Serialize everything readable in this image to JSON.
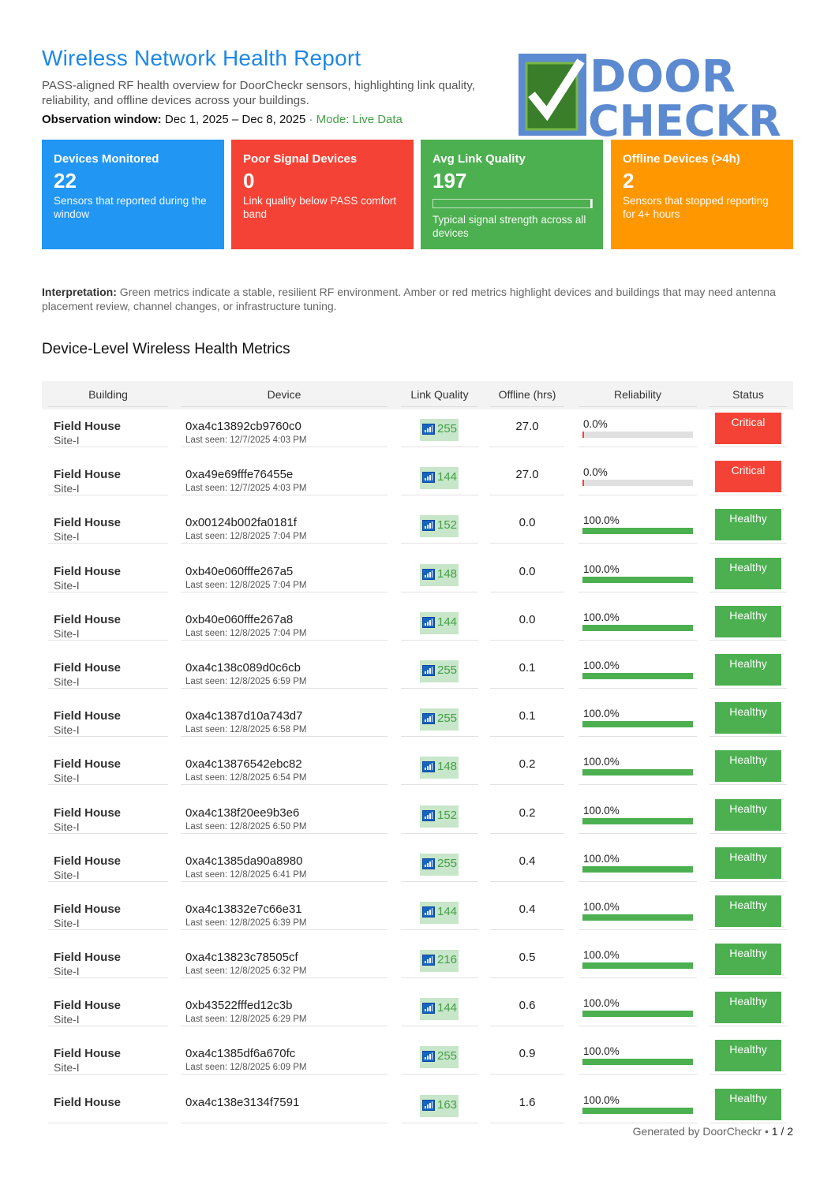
{
  "header": {
    "title": "Wireless Network Health Report",
    "subtitle": "PASS-aligned RF health overview for DoorCheckr sensors, highlighting link quality, reliability, and offline devices across your buildings.",
    "obs_label": "Observation window:",
    "obs_range": "Dec 1, 2025 – Dec 8, 2025",
    "obs_sep": " · ",
    "mode": "Mode: Live Data",
    "logo_text_1": "DOOR",
    "logo_text_2": "CHECKR"
  },
  "cards": [
    {
      "label": "Devices Monitored",
      "value": "22",
      "desc": "Sensors that reported during the window"
    },
    {
      "label": "Poor Signal Devices",
      "value": "0",
      "desc": "Link quality below PASS comfort band"
    },
    {
      "label": "Avg Link Quality",
      "value": "197",
      "desc": "Typical signal strength across all devices"
    },
    {
      "label": "Offline Devices (>4h)",
      "value": "2",
      "desc": "Sensors that stopped reporting for 4+ hours"
    }
  ],
  "avg_link_quality_fraction": 0.99,
  "interpretation": {
    "label": "Interpretation:",
    "text": " Green metrics indicate a stable, resilient RF environment. Amber or red metrics highlight devices and buildings that may need antenna placement review, channel changes, or infrastructure tuning."
  },
  "section_title": "Device-Level Wireless Health Metrics",
  "table": {
    "headers": [
      "Building",
      "Device",
      "Link Quality",
      "Offline (hrs)",
      "Reliability",
      "Status"
    ],
    "rows": [
      {
        "building": "Field House",
        "site": "Site-I",
        "device": "0xa4c13892cb9760c0",
        "seen": "Last seen: 12/7/2025 4:03 PM",
        "lq": "255",
        "offline": "27.0",
        "rel": "0.0%",
        "rel_frac": 0.0,
        "status": "Critical"
      },
      {
        "building": "Field House",
        "site": "Site-I",
        "device": "0xa49e69fffe76455e",
        "seen": "Last seen: 12/7/2025 4:03 PM",
        "lq": "144",
        "offline": "27.0",
        "rel": "0.0%",
        "rel_frac": 0.0,
        "status": "Critical"
      },
      {
        "building": "Field House",
        "site": "Site-I",
        "device": "0x00124b002fa0181f",
        "seen": "Last seen: 12/8/2025 7:04 PM",
        "lq": "152",
        "offline": "0.0",
        "rel": "100.0%",
        "rel_frac": 1.0,
        "status": "Healthy"
      },
      {
        "building": "Field House",
        "site": "Site-I",
        "device": "0xb40e060fffe267a5",
        "seen": "Last seen: 12/8/2025 7:04 PM",
        "lq": "148",
        "offline": "0.0",
        "rel": "100.0%",
        "rel_frac": 1.0,
        "status": "Healthy"
      },
      {
        "building": "Field House",
        "site": "Site-I",
        "device": "0xb40e060fffe267a8",
        "seen": "Last seen: 12/8/2025 7:04 PM",
        "lq": "144",
        "offline": "0.0",
        "rel": "100.0%",
        "rel_frac": 1.0,
        "status": "Healthy"
      },
      {
        "building": "Field House",
        "site": "Site-I",
        "device": "0xa4c138c089d0c6cb",
        "seen": "Last seen: 12/8/2025 6:59 PM",
        "lq": "255",
        "offline": "0.1",
        "rel": "100.0%",
        "rel_frac": 1.0,
        "status": "Healthy"
      },
      {
        "building": "Field House",
        "site": "Site-I",
        "device": "0xa4c1387d10a743d7",
        "seen": "Last seen: 12/8/2025 6:58 PM",
        "lq": "255",
        "offline": "0.1",
        "rel": "100.0%",
        "rel_frac": 1.0,
        "status": "Healthy"
      },
      {
        "building": "Field House",
        "site": "Site-I",
        "device": "0xa4c13876542ebc82",
        "seen": "Last seen: 12/8/2025 6:54 PM",
        "lq": "148",
        "offline": "0.2",
        "rel": "100.0%",
        "rel_frac": 1.0,
        "status": "Healthy"
      },
      {
        "building": "Field House",
        "site": "Site-I",
        "device": "0xa4c138f20ee9b3e6",
        "seen": "Last seen: 12/8/2025 6:50 PM",
        "lq": "152",
        "offline": "0.2",
        "rel": "100.0%",
        "rel_frac": 1.0,
        "status": "Healthy"
      },
      {
        "building": "Field House",
        "site": "Site-I",
        "device": "0xa4c1385da90a8980",
        "seen": "Last seen: 12/8/2025 6:41 PM",
        "lq": "255",
        "offline": "0.4",
        "rel": "100.0%",
        "rel_frac": 1.0,
        "status": "Healthy"
      },
      {
        "building": "Field House",
        "site": "Site-I",
        "device": "0xa4c13832e7c66e31",
        "seen": "Last seen: 12/8/2025 6:39 PM",
        "lq": "144",
        "offline": "0.4",
        "rel": "100.0%",
        "rel_frac": 1.0,
        "status": "Healthy"
      },
      {
        "building": "Field House",
        "site": "Site-I",
        "device": "0xa4c13823c78505cf",
        "seen": "Last seen: 12/8/2025 6:32 PM",
        "lq": "216",
        "offline": "0.5",
        "rel": "100.0%",
        "rel_frac": 1.0,
        "status": "Healthy"
      },
      {
        "building": "Field House",
        "site": "Site-I",
        "device": "0xb43522fffed12c3b",
        "seen": "Last seen: 12/8/2025 6:29 PM",
        "lq": "144",
        "offline": "0.6",
        "rel": "100.0%",
        "rel_frac": 1.0,
        "status": "Healthy"
      },
      {
        "building": "Field House",
        "site": "Site-I",
        "device": "0xa4c1385df6a670fc",
        "seen": "Last seen: 12/8/2025 6:09 PM",
        "lq": "255",
        "offline": "0.9",
        "rel": "100.0%",
        "rel_frac": 1.0,
        "status": "Healthy"
      },
      {
        "building": "Field House",
        "site": "",
        "device": "0xa4c138e3134f7591",
        "seen": "",
        "lq": "163",
        "offline": "1.6",
        "rel": "100.0%",
        "rel_frac": 1.0,
        "status": "Healthy"
      }
    ]
  },
  "footer": {
    "generated": "Generated by DoorCheckr",
    "sep": " • ",
    "page": "1 / 2"
  },
  "colors": {
    "blue": "#2196f3",
    "red": "#f44336",
    "green": "#4caf50",
    "orange": "#ff9800"
  }
}
